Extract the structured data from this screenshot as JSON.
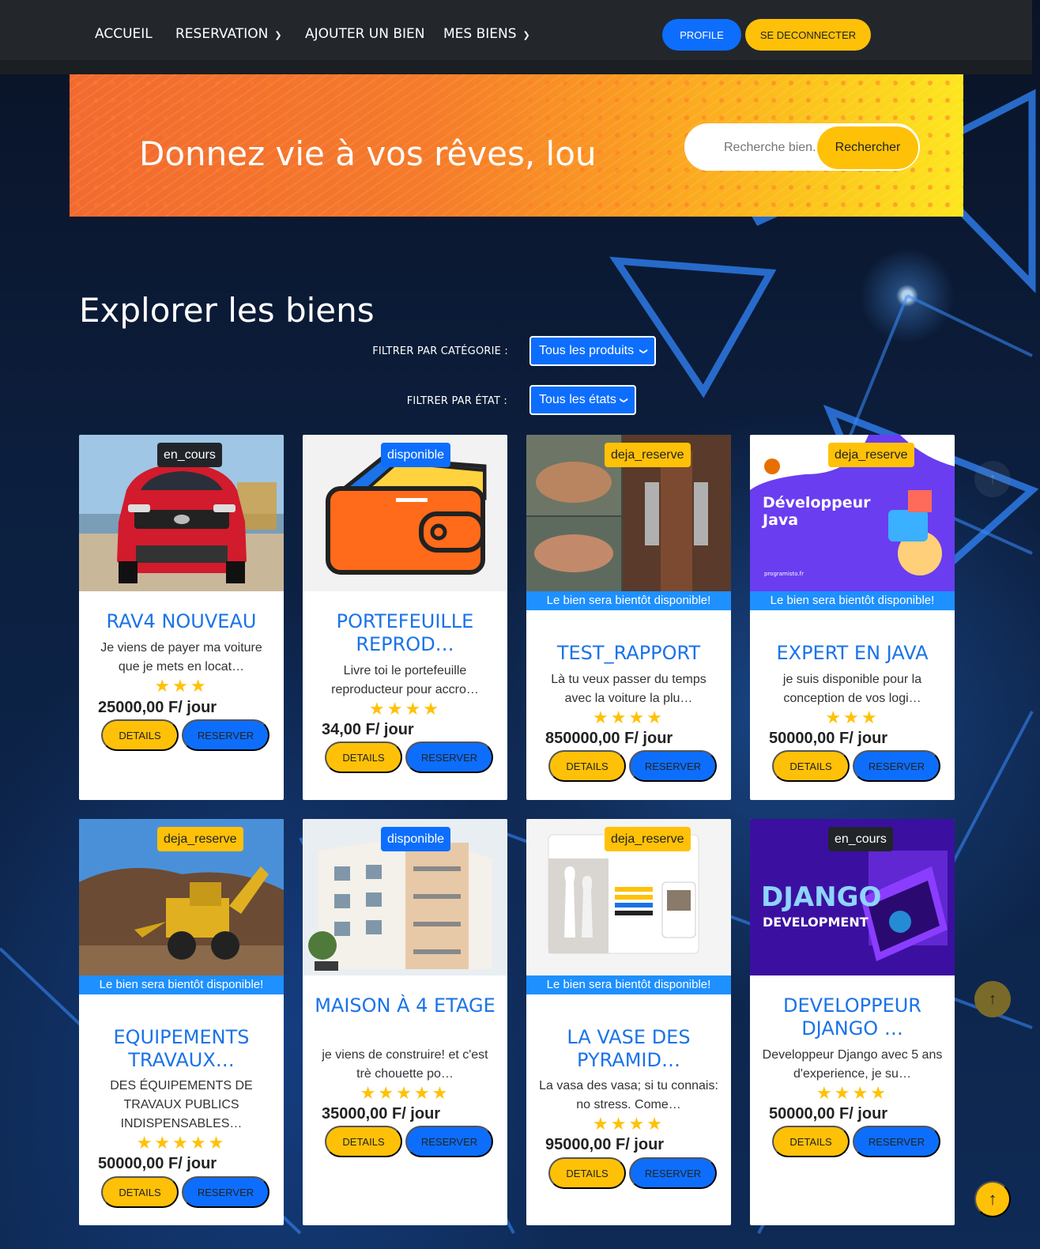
{
  "nav": {
    "links": [
      "ACCUEIL",
      "RESERVATION",
      "AJOUTER UN BIEN",
      "MES BIENS"
    ],
    "profile_label": "PROFILE",
    "logout_label": "SE DECONNECTER"
  },
  "banner": {
    "title": "Donnez vie à vos rêves, lou",
    "search_placeholder": "Recherche bien...",
    "search_button": "Rechercher"
  },
  "section": {
    "title": "Explorer les biens",
    "filter_category_label": "FILTRER PAR CATÉGORIE :",
    "filter_category_value": "Tous les produits",
    "filter_state_label": "FILTRER PAR ÉTAT :",
    "filter_state_value": "Tous les états"
  },
  "common": {
    "details_label": "DETAILS",
    "reserve_label": "RESERVER",
    "notice": "Le bien sera bientôt disponible!"
  },
  "cards": [
    {
      "badge": "en_cours",
      "title": "RAV4 NOUVEAU",
      "desc": "Je viens de payer ma voiture que je mets en locat…",
      "stars": "★★★",
      "price": "25000,00 F/ jour"
    },
    {
      "badge": "disponible",
      "title": "PORTEFEUILLE REPROD…",
      "desc": "Livre toi le portefeuille reproducteur pour accro…",
      "stars": "★★★★",
      "price": "34,00 F/ jour"
    },
    {
      "badge": "deja_reserve",
      "title": "TEST_RAPPORT",
      "desc": "Là tu veux passer du temps avec la voiture la plu…",
      "stars": "★★★★",
      "price": "850000,00 F/ jour"
    },
    {
      "badge": "deja_reserve",
      "title": "EXPERT EN JAVA",
      "desc": "je suis disponible pour la conception de vos logi…",
      "stars": "★★★",
      "price": "50000,00 F/ jour",
      "img_text_1": "Développeur",
      "img_text_2": "Java",
      "img_text_3": "programisto.fr"
    },
    {
      "badge": "deja_reserve",
      "title": "EQUIPEMENTS TRAVAUX…",
      "desc": "DES ÉQUIPEMENTS DE TRAVAUX PUBLICS INDISPENSABLES…",
      "stars": "★★★★★",
      "price": "50000,00 F/ jour"
    },
    {
      "badge": "disponible",
      "title": "MAISON À 4 ETAGE",
      "desc": "je viens de construire! et c'est trè chouette po…",
      "stars": "★★★★★",
      "price": "35000,00 F/ jour"
    },
    {
      "badge": "deja_reserve",
      "title": "LA VASE DES PYRAMID…",
      "desc": "La vasa des vasa; si tu connais: no stress. Come…",
      "stars": "★★★★",
      "price": "95000,00 F/ jour"
    },
    {
      "badge": "en_cours",
      "title": "DEVELOPPEUR DJANGO …",
      "desc": "Developpeur Django avec 5 ans d'experience, je su…",
      "stars": "★★★★",
      "price": "50000,00 F/ jour",
      "img_text_1": "DJANGO",
      "img_text_2": "DEVELOPMENT"
    }
  ],
  "colors": {
    "primary": "#0d6efd",
    "warning": "#ffc107",
    "dark": "#212529",
    "title_blue": "#1a73e8"
  },
  "icons": {
    "scroll_top": "arrow-up-icon",
    "dropdown": "chevron-down-icon"
  }
}
